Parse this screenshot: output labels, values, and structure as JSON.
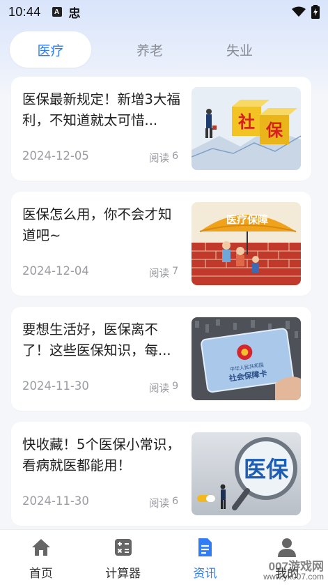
{
  "status_bar": {
    "time": "10:44",
    "a_icon": "A",
    "app_icon": "忠"
  },
  "tabs": [
    {
      "label": "医疗",
      "active": true
    },
    {
      "label": "养老",
      "active": false
    },
    {
      "label": "失业",
      "active": false
    }
  ],
  "articles": [
    {
      "title": "医保最新规定！新增3大福利，不知道就太可惜...",
      "date": "2024-12-05",
      "reads_label": "阅读",
      "reads": "6",
      "thumb_text": "社保"
    },
    {
      "title": "医保怎么用，你不会才知道吧~",
      "date": "2024-12-04",
      "reads_label": "阅读",
      "reads": "7",
      "thumb_text": "医疗保障"
    },
    {
      "title": "要想生活好，医保离不了！这些医保知识，每...",
      "date": "2024-11-30",
      "reads_label": "阅读",
      "reads": "9",
      "thumb_text": "社会保障卡"
    },
    {
      "title": "快收藏！5个医保小常识，看病就医都能用！",
      "date": "2024-11-30",
      "reads_label": "阅读",
      "reads": "6",
      "thumb_text": "医保"
    }
  ],
  "bottom_nav": [
    {
      "label": "首页",
      "icon": "home-icon",
      "active": false
    },
    {
      "label": "计算器",
      "icon": "calculator-icon",
      "active": false
    },
    {
      "label": "资讯",
      "icon": "news-icon",
      "active": true
    },
    {
      "label": "我的",
      "icon": "user-icon",
      "active": false
    }
  ],
  "watermark": {
    "main": "007游戏网",
    "sub": "www.yx007.com"
  },
  "colors": {
    "accent": "#2f7cf6",
    "text_muted": "#9a9ca2",
    "background": "#f4f6fa"
  }
}
